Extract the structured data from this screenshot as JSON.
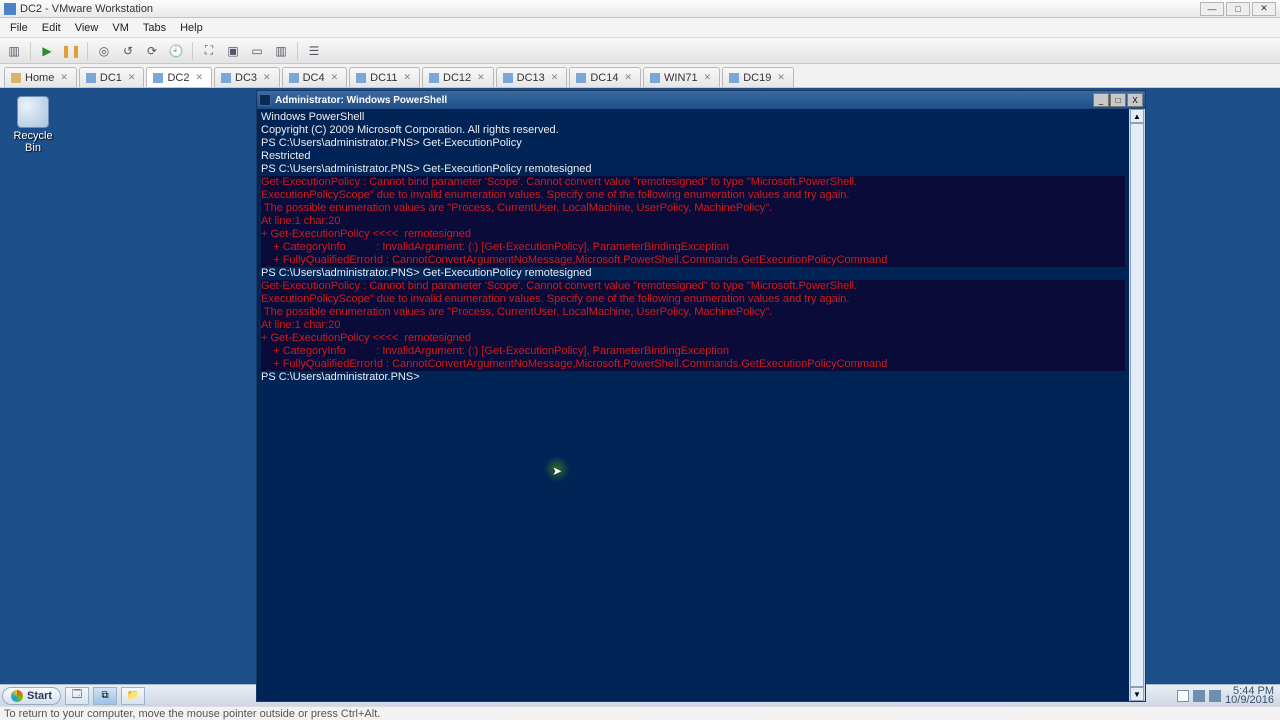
{
  "host_window": {
    "title": "DC2 - VMware Workstation",
    "controls": {
      "min": "—",
      "max": "□",
      "close": "✕"
    }
  },
  "menubar": [
    "File",
    "Edit",
    "View",
    "VM",
    "Tabs",
    "Help"
  ],
  "tabs": {
    "home": "Home",
    "items": [
      "DC1",
      "DC2",
      "DC3",
      "DC4",
      "DC11",
      "DC12",
      "DC13",
      "DC14",
      "WIN71",
      "DC19"
    ],
    "active_index": 1
  },
  "desktop": {
    "recycle_label": "Recycle Bin"
  },
  "powershell": {
    "title": "Administrator: Windows PowerShell",
    "controls": {
      "min": "_",
      "max": "□",
      "close": "X"
    },
    "lines": [
      {
        "t": "Windows PowerShell",
        "c": "n"
      },
      {
        "t": "Copyright (C) 2009 Microsoft Corporation. All rights reserved.",
        "c": "n"
      },
      {
        "t": "",
        "c": "n"
      },
      {
        "t": "PS C:\\Users\\administrator.PNS> Get-ExecutionPolicy",
        "c": "n"
      },
      {
        "t": "Restricted",
        "c": "n"
      },
      {
        "t": "PS C:\\Users\\administrator.PNS> Get-ExecutionPolicy remotesigned",
        "c": "n"
      },
      {
        "t": "Get-ExecutionPolicy : Cannot bind parameter 'Scope'. Cannot convert value \"remotesigned\" to type \"Microsoft.PowerShell.",
        "c": "e"
      },
      {
        "t": "ExecutionPolicyScope\" due to invalid enumeration values. Specify one of the following enumeration values and try again.",
        "c": "e"
      },
      {
        "t": " The possible enumeration values are \"Process, CurrentUser, LocalMachine, UserPolicy, MachinePolicy\".",
        "c": "e"
      },
      {
        "t": "At line:1 char:20",
        "c": "e"
      },
      {
        "t": "+ Get-ExecutionPolicy <<<<  remotesigned",
        "c": "e"
      },
      {
        "t": "    + CategoryInfo          : InvalidArgument: (:) [Get-ExecutionPolicy], ParameterBindingException",
        "c": "e"
      },
      {
        "t": "    + FullyQualifiedErrorId : CannotConvertArgumentNoMessage,Microsoft.PowerShell.Commands.GetExecutionPolicyCommand",
        "c": "e"
      },
      {
        "t": "",
        "c": "n"
      },
      {
        "t": "PS C:\\Users\\administrator.PNS> Get-ExecutionPolicy remotesigned",
        "c": "n"
      },
      {
        "t": "Get-ExecutionPolicy : Cannot bind parameter 'Scope'. Cannot convert value \"remotesigned\" to type \"Microsoft.PowerShell.",
        "c": "e"
      },
      {
        "t": "ExecutionPolicyScope\" due to invalid enumeration values. Specify one of the following enumeration values and try again.",
        "c": "e"
      },
      {
        "t": " The possible enumeration values are \"Process, CurrentUser, LocalMachine, UserPolicy, MachinePolicy\".",
        "c": "e"
      },
      {
        "t": "At line:1 char:20",
        "c": "e"
      },
      {
        "t": "+ Get-ExecutionPolicy <<<<  remotesigned",
        "c": "e"
      },
      {
        "t": "    + CategoryInfo          : InvalidArgument: (:) [Get-ExecutionPolicy], ParameterBindingException",
        "c": "e"
      },
      {
        "t": "    + FullyQualifiedErrorId : CannotConvertArgumentNoMessage,Microsoft.PowerShell.Commands.GetExecutionPolicyCommand",
        "c": "e"
      },
      {
        "t": "",
        "c": "n"
      },
      {
        "t": "PS C:\\Users\\administrator.PNS>",
        "c": "n"
      }
    ]
  },
  "guest_taskbar": {
    "start": "Start",
    "clock_time": "5:44 PM",
    "clock_date": "10/9/2016"
  },
  "statusbar": {
    "text": "To return to your computer, move the mouse pointer outside or press Ctrl+Alt."
  }
}
